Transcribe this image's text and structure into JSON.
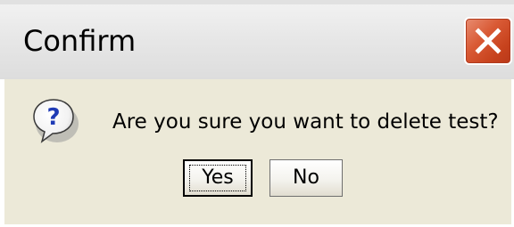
{
  "dialog": {
    "title": "Confirm",
    "message": "Are you sure you want to delete test?",
    "icon": "question-icon",
    "close_icon": "close-icon",
    "buttons": {
      "yes_label": "Yes",
      "no_label": "No"
    },
    "focused_button": "Yes"
  },
  "colors": {
    "dialog_body": "#ece9d8",
    "close_button": "#d95a35",
    "question_mark": "#1f3bb5"
  }
}
